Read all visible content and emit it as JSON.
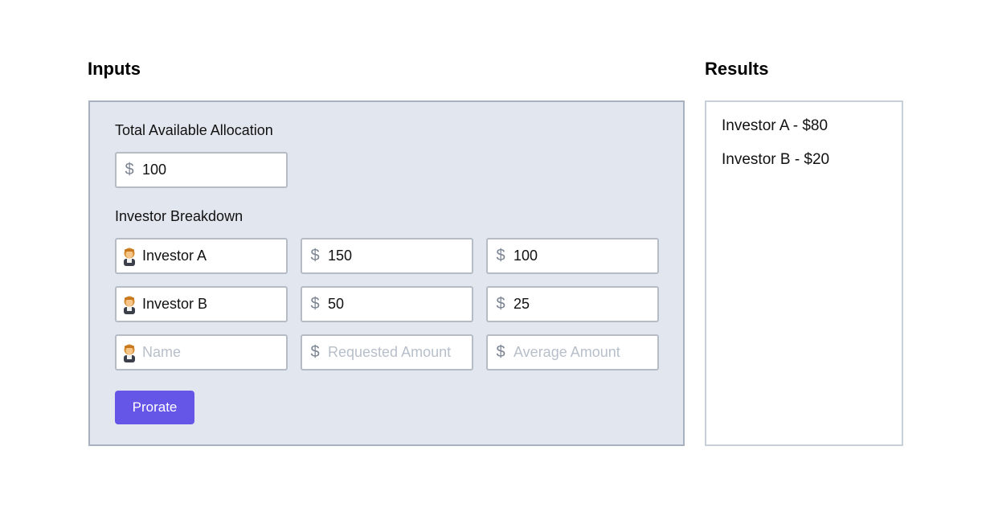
{
  "inputs_heading": "Inputs",
  "results_heading": "Results",
  "total_allocation": {
    "label": "Total Available Allocation",
    "currency_symbol": "$",
    "value": "100"
  },
  "investor_breakdown": {
    "label": "Investor Breakdown",
    "rows": [
      {
        "name": "Investor A",
        "requested": "150",
        "average": "100"
      },
      {
        "name": "Investor B",
        "requested": "50",
        "average": "25"
      }
    ],
    "new_row": {
      "name_placeholder": "Name",
      "requested_placeholder": "Requested Amount",
      "average_placeholder": "Average Amount"
    },
    "currency_symbol": "$",
    "row_icon": "person-icon"
  },
  "prorate_button": {
    "label": "Prorate",
    "color": "#6556e8"
  },
  "results": [
    "Investor A - $80",
    "Investor B - $20"
  ]
}
